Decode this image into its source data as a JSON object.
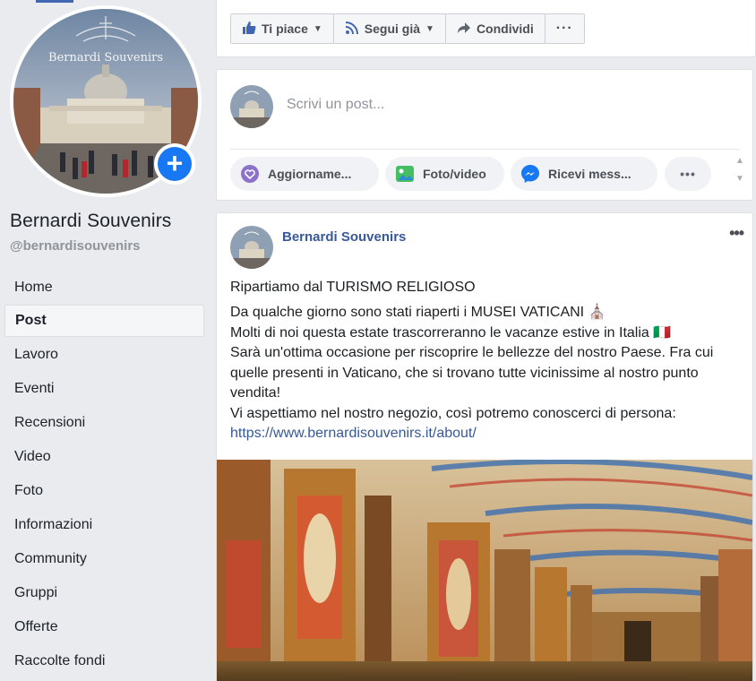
{
  "page": {
    "name": "Bernardi Souvenirs",
    "handle": "@bernardisouvenirs",
    "avatar_watermark": "Bernardi Souvenirs"
  },
  "nav": {
    "items": [
      "Home",
      "Post",
      "Lavoro",
      "Eventi",
      "Recensioni",
      "Video",
      "Foto",
      "Informazioni",
      "Community",
      "Gruppi",
      "Offerte",
      "Raccolte fondi"
    ],
    "active": "Post"
  },
  "actions": {
    "like_label": "Ti piace",
    "follow_label": "Segui già",
    "share_label": "Condividi",
    "more_label": "···"
  },
  "composer": {
    "placeholder": "Scrivi un post...",
    "update_label": "Aggiorname...",
    "photo_label": "Foto/video",
    "messages_label": "Ricevi mess...",
    "more_label": "•••"
  },
  "post": {
    "author": "Bernardi Souvenirs",
    "more_label": "•••",
    "headline": "Ripartiamo dal TURISMO RELIGIOSO",
    "line1": "Da qualche giorno sono stati riaperti i MUSEI VATICANI ⛪",
    "line2": "Molti di noi questa estate trascorreranno le vacanze estive in Italia 🇮🇹",
    "line3": "Sarà un'ottima occasione per riscoprire le bellezze del nostro Paese. Fra cui quelle presenti in Vaticano, che si trovano tutte vicinissime al nostro punto vendita!",
    "line4": "Vi aspettiamo nel nostro negozio, così potremo conoscerci di persona:",
    "link": "https://www.bernardisouvenirs.it/about/"
  },
  "colors": {
    "facebook_blue": "#4267b2",
    "link": "#385898",
    "add_button": "#1877f2"
  }
}
